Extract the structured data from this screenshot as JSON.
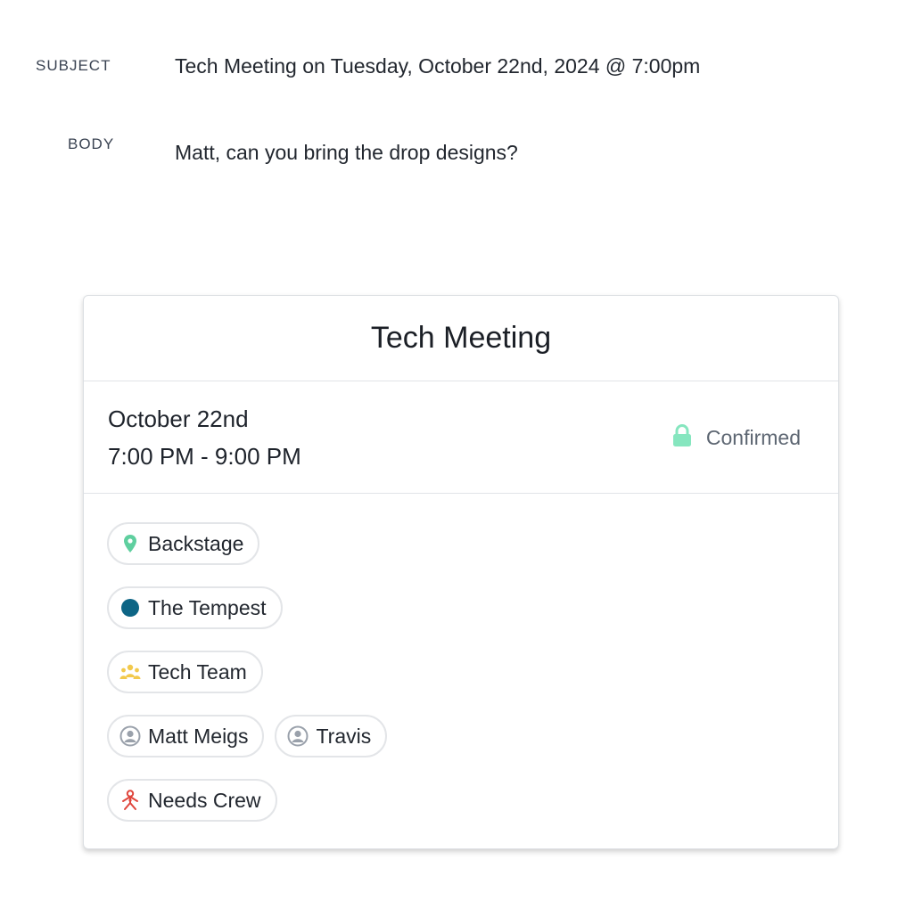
{
  "email": {
    "subject_label": "SUBJECT",
    "subject": "Tech Meeting on Tuesday, October 22nd, 2024 @ 7:00pm",
    "body_label": "BODY",
    "body": "Matt, can you bring the drop designs?"
  },
  "event": {
    "title": "Tech Meeting",
    "date": "October 22nd",
    "time": "7:00 PM - 9:00 PM",
    "status": "Confirmed",
    "status_icon": "lock-icon",
    "colors": {
      "lock": "#86e6bf",
      "location": "#5fcf9f",
      "production": "#0d6585",
      "team": "#f2c94c",
      "person": "#9aa1ab",
      "needs": "#e0463c"
    },
    "location": {
      "label": "Backstage",
      "icon": "map-pin-icon"
    },
    "production": {
      "label": "The Tempest",
      "icon": "dot-icon"
    },
    "team": {
      "label": "Tech Team",
      "icon": "group-icon"
    },
    "people": [
      {
        "label": "Matt Meigs",
        "icon": "user-avatar-icon"
      },
      {
        "label": "Travis",
        "icon": "user-avatar-icon"
      }
    ],
    "needs": {
      "label": "Needs Crew",
      "icon": "crew-needed-icon"
    }
  }
}
